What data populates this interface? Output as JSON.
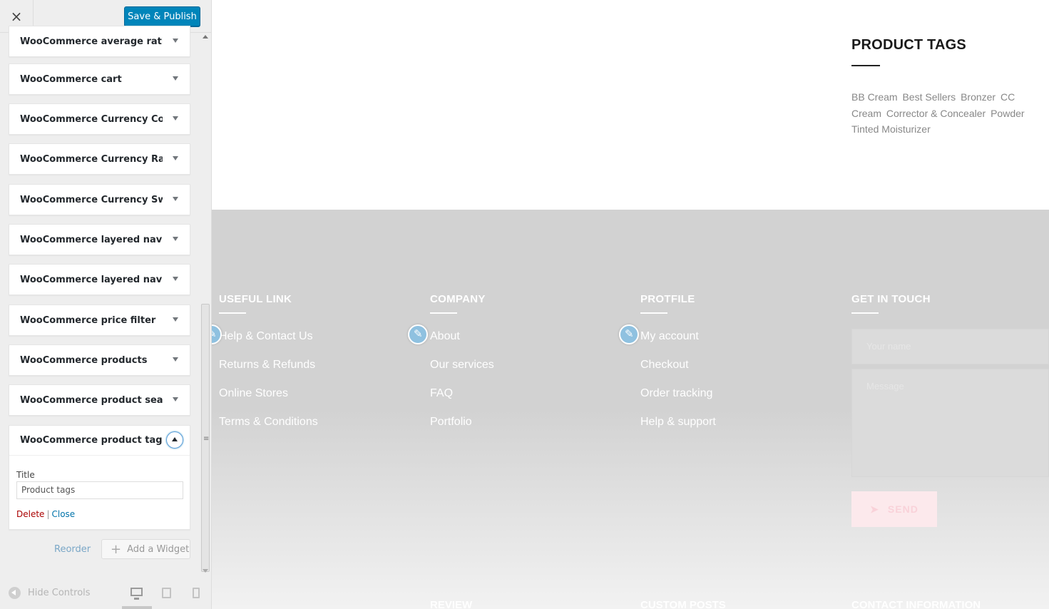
{
  "topbar": {
    "close_icon": "×",
    "publish_label": "Save & Publish"
  },
  "widgets": [
    "WooCommerce average ratin...",
    "WooCommerce cart",
    "WooCommerce Currency Con...",
    "WooCommerce Currency Rate...",
    "WooCommerce Currency Swit...",
    "WooCommerce layered nav: F...",
    "WooCommerce layered nav fil...",
    "WooCommerce price filter",
    "WooCommerce products",
    "WooCommerce product search"
  ],
  "expanded_widget": {
    "label": "WooCommerce product tags",
    "field_label": "Title",
    "field_value": "Product tags",
    "delete_label": "Delete",
    "separator": "|",
    "close_label": "Close"
  },
  "sidebar_footer": {
    "reorder_label": "Reorder",
    "add_widget_label": "Add a Widget",
    "hide_controls_label": "Hide Controls"
  },
  "preview": {
    "tags_title": "PRODUCT TAGS",
    "tags": [
      "BB Cream",
      "Best Sellers",
      "Bronzer",
      "CC Cream",
      "Corrector & Concealer",
      "Powder",
      "Tinted Moisturizer"
    ],
    "columns": [
      {
        "title": "USEFUL LINK",
        "links": [
          "Help & Contact Us",
          "Returns & Refunds",
          "Online Stores",
          "Terms & Conditions"
        ]
      },
      {
        "title": "COMPANY",
        "links": [
          "About",
          "Our services",
          "FAQ",
          "Portfolio"
        ]
      },
      {
        "title": "PROTFILE",
        "links": [
          "My account",
          "Checkout",
          "Order tracking",
          "Help & support"
        ]
      }
    ],
    "contact": {
      "title": "GET IN TOUCH",
      "name_placeholder": "Your name",
      "message_placeholder": "Message",
      "send_label": "SEND"
    },
    "bottom_titles": [
      "REVIEW",
      "CUSTOM POSTS",
      "CONTACT INFORMATION"
    ]
  },
  "colors": {
    "primary": "#0085ba",
    "footer_bg": "#d2d2d2",
    "delete": "#aa0000",
    "link": "#0073aa"
  },
  "icons": [
    "close-icon",
    "chevron-down-icon",
    "chevron-up-icon",
    "plus-icon",
    "collapse-icon",
    "desktop-icon",
    "tablet-icon",
    "mobile-icon",
    "pencil-icon",
    "send-icon"
  ]
}
